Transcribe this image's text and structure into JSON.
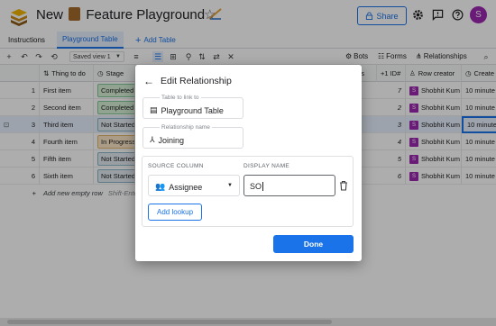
{
  "app": {
    "title": "New",
    "title_rest": "Feature Playground",
    "share_label": "Share",
    "avatar_letter": "S"
  },
  "tabs": [
    {
      "label": "Instructions"
    },
    {
      "label": "Playground Table"
    },
    {
      "label": "Add Table"
    }
  ],
  "toolbar": {
    "saved_view": "Saved view 1",
    "bots_label": "Bots",
    "forms_label": "Forms",
    "relationships_label": "Relationships"
  },
  "grid": {
    "headers": {
      "thing": "Thing to do",
      "stage": "Stage",
      "id": "ID#",
      "creator": "Row creator",
      "created": "Create",
      "nts": "nts"
    },
    "rows": [
      {
        "num": "1",
        "thing": "First item",
        "stage": "Completed",
        "id": "7",
        "creator": "Shobhit Kum",
        "created": "10 minute"
      },
      {
        "num": "2",
        "thing": "Second item",
        "stage": "Completed",
        "id": "2",
        "creator": "Shobhit Kum",
        "created": "10 minute"
      },
      {
        "num": "3",
        "thing": "Third item",
        "stage": "Not Started",
        "id": "3",
        "creator": "Shobhit Kum",
        "created": "10 minute"
      },
      {
        "num": "4",
        "thing": "Fourth item",
        "stage": "In Progress",
        "id": "4",
        "creator": "Shobhit Kum",
        "created": "10 minute"
      },
      {
        "num": "5",
        "thing": "Fifth item",
        "stage": "Not Started",
        "id": "5",
        "creator": "Shobhit Kum",
        "created": "10 minute"
      },
      {
        "num": "6",
        "thing": "Sixth item",
        "stage": "Not Started",
        "id": "6",
        "creator": "Shobhit Kum",
        "created": "10 minute"
      }
    ],
    "add_row": "Add new empty row",
    "add_row_hint": "Shift-Enter",
    "user_badge": "S"
  },
  "dialog": {
    "title": "Edit Relationship",
    "table_label": "Table to link to",
    "table_value": "Playground Table",
    "rel_label": "Relationship name",
    "rel_value": "Joining",
    "source_col_header": "SOURCE COLUMN",
    "display_name_header": "DISPLAY NAME",
    "source_value": "Assignee",
    "display_value": "SO",
    "add_lookup": "Add lookup",
    "done": "Done"
  },
  "colors": {
    "accent": "#1a73e8",
    "avatar": "#9c27b0"
  }
}
